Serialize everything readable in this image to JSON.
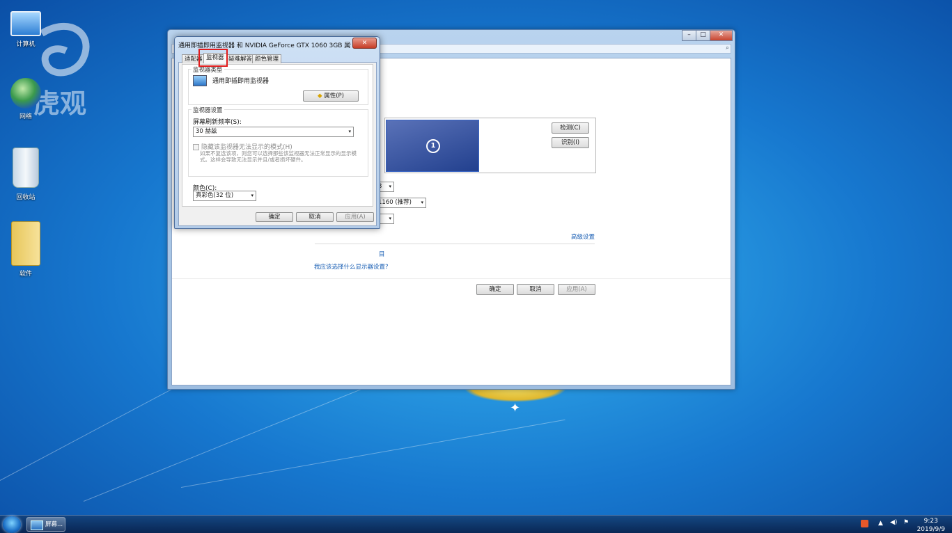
{
  "desktop": {
    "icons": [
      {
        "label": "计算机"
      },
      {
        "label": "网络"
      },
      {
        "label": "回收站"
      },
      {
        "label": "软件"
      }
    ],
    "watermark_text": "虎观"
  },
  "main_window": {
    "buttons": {
      "minimize": "–",
      "maximize": "□",
      "close": "✕",
      "search": "⌕"
    },
    "monitor_number": "1",
    "detect_label": "检测(C)",
    "identify_label": "识别(I)",
    "combo1_value": "3",
    "combo2_value": "1160 (推荐)",
    "combo3_value": "",
    "advanced_link": "高级设置",
    "link1": "目",
    "link2": "我应该选择什么显示器设置?",
    "ok_label": "确定",
    "cancel_label": "取消",
    "apply_label": "应用(A)"
  },
  "dialog": {
    "title": "通用即插即用监视器 和 NVIDIA GeForce GTX 1060 3GB 属性",
    "close": "✕",
    "tabs": [
      "适配器",
      "监视器",
      "疑难解答",
      "颜色管理"
    ],
    "active_tab_index": 1,
    "monitor_type_group": "监视器类型",
    "monitor_type_name": "通用即插即用监视器",
    "properties_button": "属性(P)",
    "monitor_settings_group": "监视器设置",
    "refresh_label": "屏幕刷新频率(S):",
    "refresh_value": "30 赫兹",
    "hide_modes_label": "隐藏该监视器无法显示的模式(H)",
    "hide_modes_note": "如果不复选该项，则您可以选择那些该监视器无法正常显示的显示模式。这样会导致无法显示并且/或者损坏硬件。",
    "color_label": "颜色(C):",
    "color_value": "真彩色(32 位)",
    "ok_label": "确定",
    "cancel_label": "取消",
    "apply_label": "应用(A)"
  },
  "taskbar": {
    "task_label": "屏幕...",
    "clock_time": "9:23",
    "clock_date": "2019/9/9",
    "tray_icons": [
      "sogou-icon",
      "show-hidden-icon",
      "volume-icon",
      "action-center-icon"
    ]
  }
}
